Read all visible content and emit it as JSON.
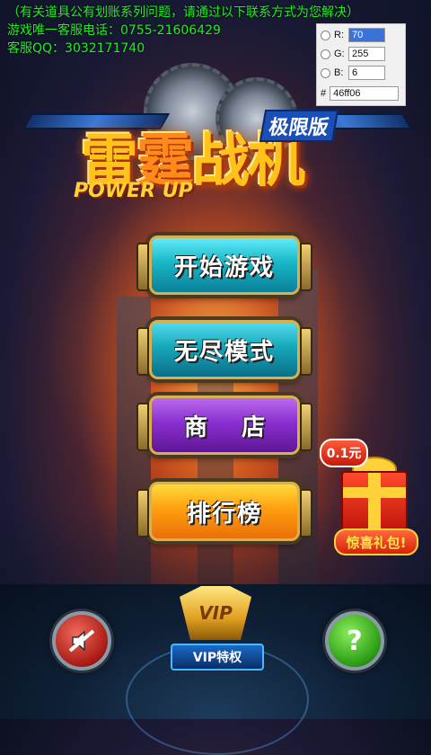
{
  "notice": {
    "line1": "（有关道具公有划账系列问题，请通过以下联系方式为您解决）",
    "line2": "游戏唯一客服电话：0755-21606429",
    "line3": "客服QQ：3032171740"
  },
  "color_picker": {
    "r_label": "R:",
    "g_label": "G:",
    "b_label": "B:",
    "hash_label": "#",
    "r_value": "70",
    "g_value": "255",
    "b_value": "6",
    "hex_value": "46ff06"
  },
  "logo": {
    "title_a": "雷",
    "title_b": "霆",
    "title_c": "战机",
    "edition": "极限版",
    "powerup": "POWER UP"
  },
  "menu": {
    "start": "开始游戏",
    "endless": "无尽模式",
    "shop": "商店",
    "rank": "排行榜"
  },
  "gift": {
    "price": "0.1元",
    "label": "惊喜礼包!"
  },
  "bottom": {
    "vip_emblem": "VIP",
    "vip_label": "VIP特权",
    "help_glyph": "?"
  }
}
